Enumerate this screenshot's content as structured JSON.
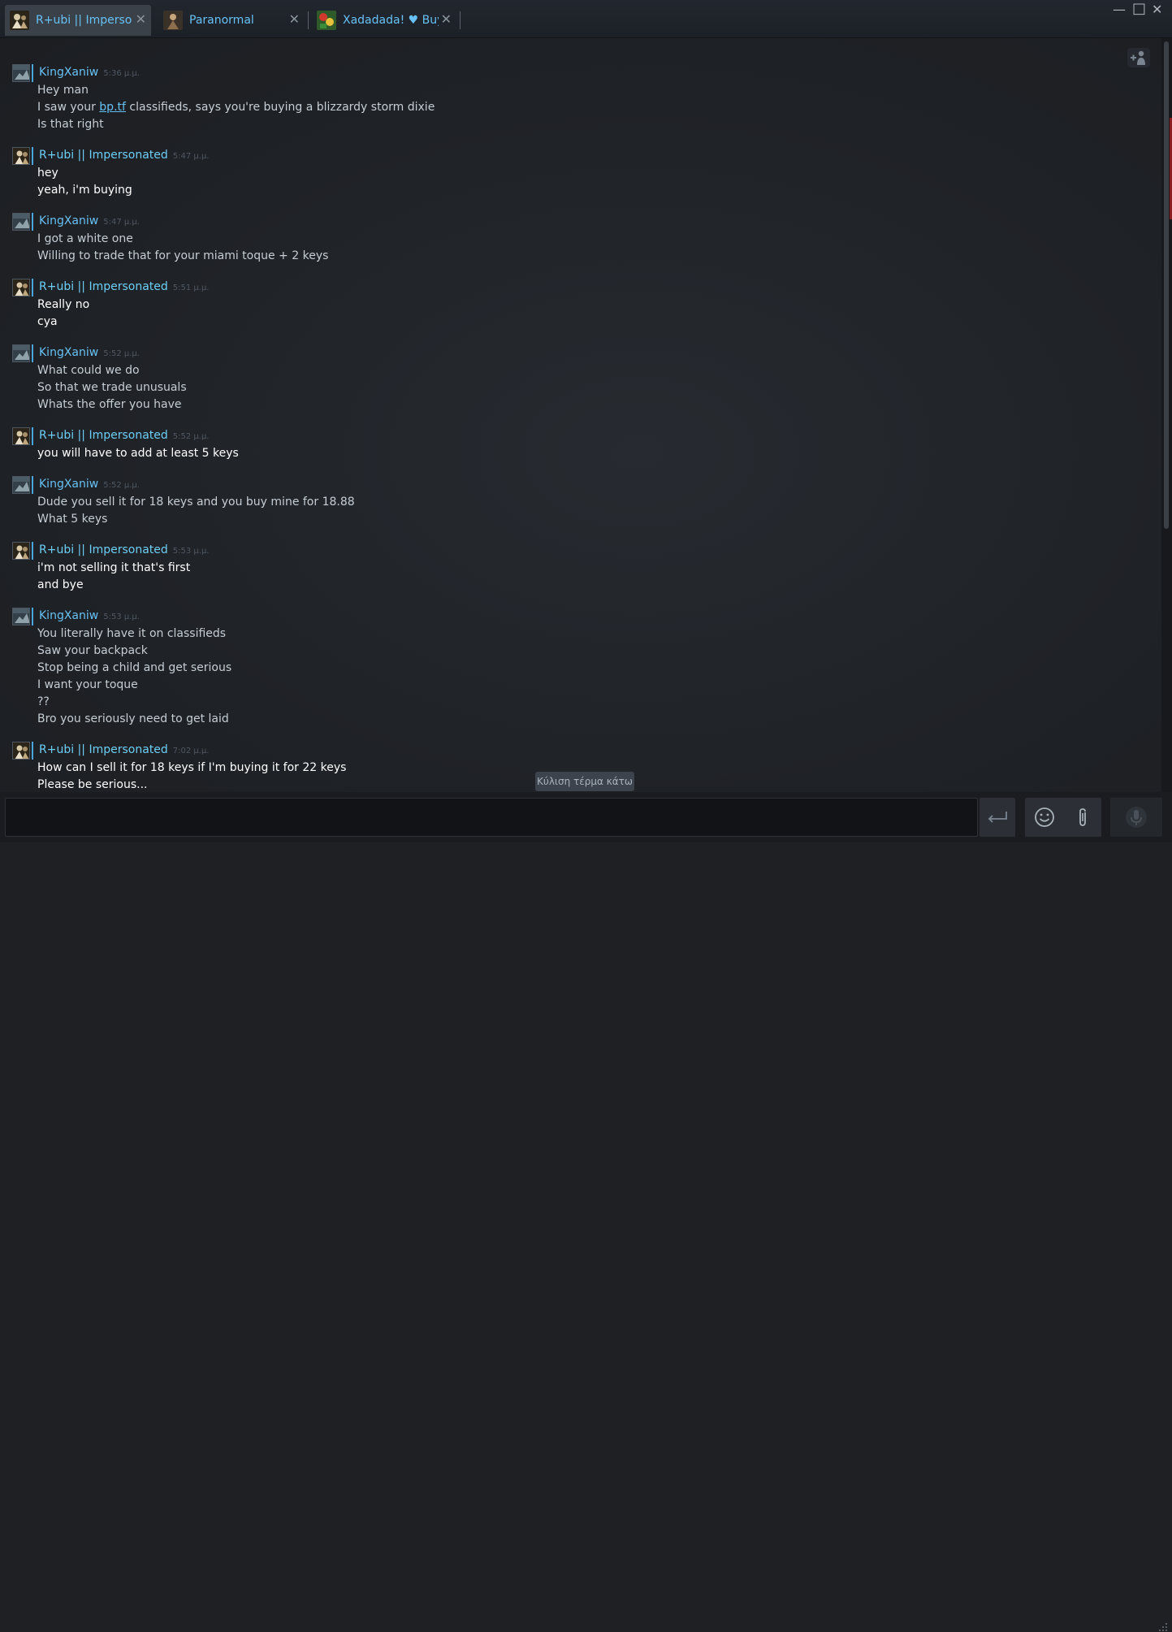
{
  "tabs": [
    {
      "name": "R+ubi || Impersona",
      "active": true
    },
    {
      "name": "Paranormal",
      "active": false
    },
    {
      "name": "Xadadada! ♥ Buyi",
      "active": false
    }
  ],
  "icons": {
    "tab_close": "✕",
    "window_minimize": "—",
    "window_maximize": "□",
    "window_close": "✕"
  },
  "colors": {
    "friend_name": "#67c1f5",
    "self_name": "#6dcff6",
    "friend_text": "#c5cdd5",
    "self_text": "#ffffff",
    "background": "#1e2024"
  },
  "messages": [
    {
      "sender": "KingXaniw",
      "time": "5:36 μ.μ.",
      "self": false,
      "lines": [
        "Hey man",
        "I saw your {link}bp.tf{/link} classifieds, says you're buying a blizzardy storm dixie",
        "Is that right"
      ]
    },
    {
      "sender": "R+ubi || Impersonated",
      "time": "5:47 μ.μ.",
      "self": true,
      "lines": [
        "hey",
        "yeah, i'm buying"
      ]
    },
    {
      "sender": "KingXaniw",
      "time": "5:47 μ.μ.",
      "self": false,
      "lines": [
        "I got a white one",
        "Willing to trade that for your miami toque + 2 keys"
      ]
    },
    {
      "sender": "R+ubi || Impersonated",
      "time": "5:51 μ.μ.",
      "self": true,
      "lines": [
        "Really no",
        "cya"
      ]
    },
    {
      "sender": "KingXaniw",
      "time": "5:52 μ.μ.",
      "self": false,
      "lines": [
        "What could we do",
        "So that we trade unusuals",
        "Whats the offer you have"
      ]
    },
    {
      "sender": "R+ubi || Impersonated",
      "time": "5:52 μ.μ.",
      "self": true,
      "lines": [
        "you will have to add at least 5 keys"
      ]
    },
    {
      "sender": "KingXaniw",
      "time": "5:52 μ.μ.",
      "self": false,
      "lines": [
        "Dude you sell it for 18 keys and you buy mine for 18.88",
        "What 5 keys"
      ]
    },
    {
      "sender": "R+ubi || Impersonated",
      "time": "5:53 μ.μ.",
      "self": true,
      "lines": [
        "i'm not selling it that's first",
        "and bye"
      ]
    },
    {
      "sender": "KingXaniw",
      "time": "5:53 μ.μ.",
      "self": false,
      "lines": [
        "You literally have it on classifieds",
        "Saw your backpack",
        "Stop being a child and get serious",
        "I want your toque",
        "??",
        "Bro you seriously need to get laid"
      ]
    },
    {
      "sender": "R+ubi || Impersonated",
      "time": "7:02 μ.μ.",
      "self": true,
      "lines": [
        "How can I sell it for 18 keys if I'm buying it for 22 keys",
        "Please be serious..."
      ]
    }
  ],
  "scroll_to_bottom_label": "Κύλιση τέρμα κάτω",
  "composer": {
    "input_value": "",
    "send_icon": "enter-arrow-icon",
    "emoji_icon": "smiley-icon",
    "attach_icon": "paperclip-icon",
    "voice_icon": "microphone-icon"
  }
}
